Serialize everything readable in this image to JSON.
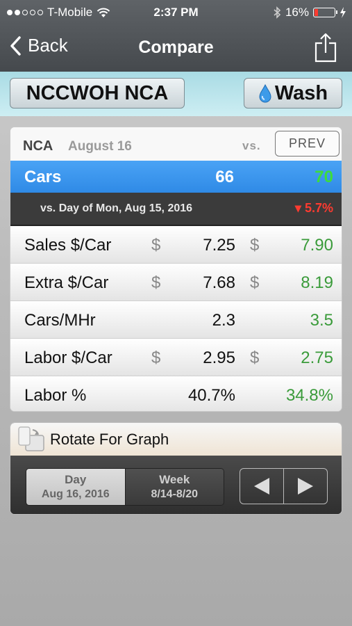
{
  "status": {
    "carrier": "T-Mobile",
    "time": "2:37 PM",
    "battery": "16%",
    "signal_bars": 2
  },
  "nav": {
    "back_label": "Back",
    "title": "Compare"
  },
  "site_bar": {
    "site_button": "NCCWOH NCA",
    "wash_button": "Wash"
  },
  "card": {
    "site": "NCA",
    "date": "August 16",
    "vs_label": "vs.",
    "prev_button": "PREV",
    "cars": {
      "label": "Cars",
      "current": "66",
      "compare": "70"
    },
    "comparison": {
      "text": "vs. Day of Mon, Aug 15, 2016",
      "change": "▾ 5.7%"
    },
    "metrics": [
      {
        "label": "Sales $/Car",
        "cur_prefix": "$",
        "current": "7.25",
        "cmp_prefix": "$",
        "compare": "7.90"
      },
      {
        "label": "Extra $/Car",
        "cur_prefix": "$",
        "current": "7.68",
        "cmp_prefix": "$",
        "compare": "8.19"
      },
      {
        "label": "Cars/MHr",
        "cur_prefix": "",
        "current": "2.3",
        "cmp_prefix": "",
        "compare": "3.5"
      },
      {
        "label": "Labor $/Car",
        "cur_prefix": "$",
        "current": "2.95",
        "cmp_prefix": "$",
        "compare": "2.75"
      },
      {
        "label": "Labor %",
        "cur_prefix": "",
        "current": "40.7%",
        "cmp_prefix": "",
        "compare": "34.8%"
      }
    ]
  },
  "graph": {
    "rotate_label": "Rotate For Graph",
    "segments": [
      {
        "title": "Day",
        "sub": "Aug 16, 2016",
        "selected": true
      },
      {
        "title": "Week",
        "sub": "8/14-8/20",
        "selected": false
      }
    ]
  },
  "colors": {
    "accent_blue": "#3a93ee",
    "positive_green": "#3a9b3a",
    "negative_red": "#ff3b30"
  }
}
